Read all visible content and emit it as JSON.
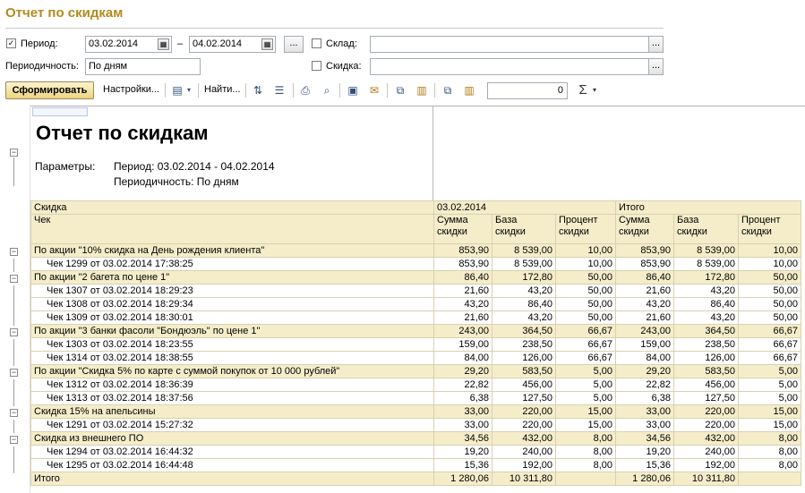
{
  "title": "Отчет по скидкам",
  "filters": {
    "period_label": "Период:",
    "period_checked": true,
    "date_from": "03.02.2014",
    "date_to": "04.02.2014",
    "dash": "–",
    "dots": "...",
    "warehouse_label": "Склад:",
    "warehouse_value": "",
    "periodicity_label": "Периодичность:",
    "periodicity_value": "По дням",
    "discount_label": "Скидка:",
    "discount_value": ""
  },
  "toolbar": {
    "generate": "Сформировать",
    "settings": "Настройки...",
    "find": "Найти...",
    "sum_value": "0",
    "sigma": "Σ"
  },
  "report": {
    "title": "Отчет по скидкам",
    "params_label": "Параметры:",
    "period_line": "Период: 03.02.2014 - 04.02.2014",
    "periodicity_line": "Периодичность: По дням",
    "header": {
      "col1_top": "Скидка",
      "col1_bottom": "Чек",
      "date": "03.02.2014",
      "total": "Итого",
      "sum": [
        "Сумма",
        "скидки"
      ],
      "base": [
        "База",
        "скидки"
      ],
      "pct": [
        "Процент",
        "скидки"
      ]
    },
    "rows": [
      {
        "type": "grp",
        "name": "По акции \"10% скидка на День рождения клиента\"",
        "v": [
          "853,90",
          "8 539,00",
          "10,00",
          "853,90",
          "8 539,00",
          "10,00"
        ]
      },
      {
        "type": "det",
        "name": "Чек 1299 от 03.02.2014 17:38:25",
        "v": [
          "853,90",
          "8 539,00",
          "10,00",
          "853,90",
          "8 539,00",
          "10,00"
        ]
      },
      {
        "type": "grp",
        "name": "По акции \"2 багета по цене 1\"",
        "v": [
          "86,40",
          "172,80",
          "50,00",
          "86,40",
          "172,80",
          "50,00"
        ]
      },
      {
        "type": "det",
        "name": "Чек 1307 от 03.02.2014 18:29:23",
        "v": [
          "21,60",
          "43,20",
          "50,00",
          "21,60",
          "43,20",
          "50,00"
        ]
      },
      {
        "type": "det",
        "name": "Чек 1308 от 03.02.2014 18:29:34",
        "v": [
          "43,20",
          "86,40",
          "50,00",
          "43,20",
          "86,40",
          "50,00"
        ]
      },
      {
        "type": "det",
        "name": "Чек 1309 от 03.02.2014 18:30:01",
        "v": [
          "21,60",
          "43,20",
          "50,00",
          "21,60",
          "43,20",
          "50,00"
        ]
      },
      {
        "type": "grp",
        "name": "По акции \"3 банки фасоли \"Бондюэль\" по цене 1\"",
        "v": [
          "243,00",
          "364,50",
          "66,67",
          "243,00",
          "364,50",
          "66,67"
        ]
      },
      {
        "type": "det",
        "name": "Чек 1303 от 03.02.2014 18:23:55",
        "v": [
          "159,00",
          "238,50",
          "66,67",
          "159,00",
          "238,50",
          "66,67"
        ]
      },
      {
        "type": "det",
        "name": "Чек 1314 от 03.02.2014 18:38:55",
        "v": [
          "84,00",
          "126,00",
          "66,67",
          "84,00",
          "126,00",
          "66,67"
        ]
      },
      {
        "type": "grp",
        "name": "По акции \"Скидка 5% по  карте с суммой покупок от 10 000 рублей\"",
        "v": [
          "29,20",
          "583,50",
          "5,00",
          "29,20",
          "583,50",
          "5,00"
        ]
      },
      {
        "type": "det",
        "name": "Чек 1312 от 03.02.2014 18:36:39",
        "v": [
          "22,82",
          "456,00",
          "5,00",
          "22,82",
          "456,00",
          "5,00"
        ]
      },
      {
        "type": "det",
        "name": "Чек 1313 от 03.02.2014 18:37:56",
        "v": [
          "6,38",
          "127,50",
          "5,00",
          "6,38",
          "127,50",
          "5,00"
        ]
      },
      {
        "type": "grp",
        "name": "Скидка 15% на апельсины",
        "v": [
          "33,00",
          "220,00",
          "15,00",
          "33,00",
          "220,00",
          "15,00"
        ]
      },
      {
        "type": "det",
        "name": "Чек 1291 от 03.02.2014 15:27:32",
        "v": [
          "33,00",
          "220,00",
          "15,00",
          "33,00",
          "220,00",
          "15,00"
        ]
      },
      {
        "type": "grp",
        "name": "Скидка из внешнего ПО",
        "v": [
          "34,56",
          "432,00",
          "8,00",
          "34,56",
          "432,00",
          "8,00"
        ]
      },
      {
        "type": "det",
        "name": "Чек 1294 от 03.02.2014 16:44:32",
        "v": [
          "19,20",
          "240,00",
          "8,00",
          "19,20",
          "240,00",
          "8,00"
        ]
      },
      {
        "type": "det",
        "name": "Чек 1295 от 03.02.2014 16:44:48",
        "v": [
          "15,36",
          "192,00",
          "8,00",
          "15,36",
          "192,00",
          "8,00"
        ]
      }
    ],
    "total": {
      "name": "Итого",
      "v": [
        "1 280,06",
        "10 311,80",
        "",
        "1 280,06",
        "10 311,80",
        ""
      ]
    }
  }
}
